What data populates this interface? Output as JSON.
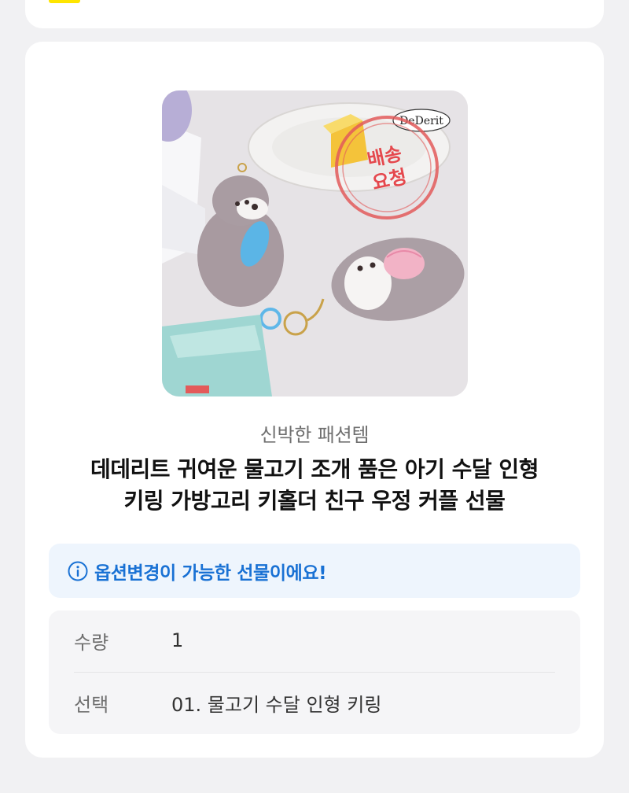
{
  "product": {
    "image_label": "배송 요청",
    "image_brand_mark": "DeDerit",
    "brand": "신박한 패션템",
    "title_line1": "데데리트 귀여운 물고기 조개 품은 아기 수달 인형",
    "title_line2": "키링 가방고리 키홀더 친구 우정 커플 선물"
  },
  "notice": {
    "icon": "info-icon",
    "text": "옵션변경이 가능한 선물이에요!",
    "color": "#1971d4"
  },
  "details": {
    "quantity_label": "수량",
    "quantity_value": "1",
    "option_label": "선택",
    "option_value": "01. 물고기 수달 인형 키링"
  }
}
